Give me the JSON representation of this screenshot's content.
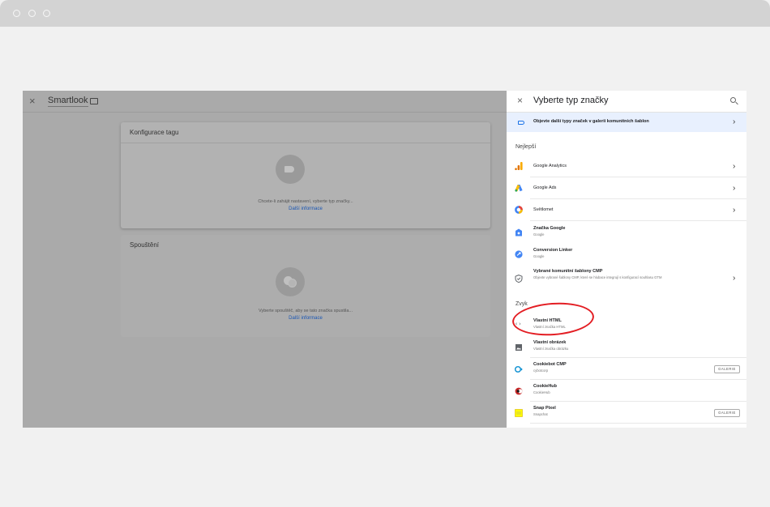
{
  "window": {
    "controls": [
      "close",
      "minimize",
      "zoom"
    ]
  },
  "left_panel": {
    "close_label": "×",
    "title": "Smartlook",
    "tag_card": {
      "title": "Konfigurace tagu",
      "hint": "Chcete-li zahájit nastavení, vyberte typ značky...",
      "link": "Další informace"
    },
    "trigger_card": {
      "title": "Spouštění",
      "hint": "Vyberte spouštěč, aby se tato značka spustila...",
      "link": "Další informace"
    }
  },
  "right_panel": {
    "close_label": "×",
    "title": "Vyberte typ značky",
    "banner": {
      "text": "Objevte další typy značek v galerii komunitních šablon",
      "chevron": "›"
    },
    "sections": {
      "best": "Nejlepší",
      "custom": "Zvyk"
    },
    "best_items": [
      {
        "name": "Google Analytics",
        "icon": "google-analytics-icon",
        "chevron": "›"
      },
      {
        "name": "Google Ads",
        "icon": "google-ads-icon",
        "chevron": "›"
      },
      {
        "name": "Světlomet",
        "icon": "floodlight-icon",
        "chevron": "›"
      },
      {
        "name": "Značka Google",
        "sub": "Google",
        "icon": "google-tag-icon"
      },
      {
        "name": "Conversion Linker",
        "sub": "Google",
        "icon": "conversion-linker-icon"
      },
      {
        "name": "Vybrané komunitní šablony CMP",
        "sub": "Objevte vybrané šablony CMP, které se hlubace integrují s konfigurací souhlasu GTM",
        "icon": "shield-icon",
        "chevron": "›"
      }
    ],
    "custom_items": [
      {
        "name": "Vlastní HTML",
        "sub": "Vlastní značka HTML",
        "icon": "code-icon"
      },
      {
        "name": "Vlastní obrázek",
        "sub": "Vlastní značka obrázku",
        "icon": "image-icon"
      },
      {
        "name": "Cookiebot CMP",
        "sub": "cybotcorp",
        "icon": "cookiebot-icon",
        "badge": "GALERIE"
      },
      {
        "name": "CookieHub",
        "sub": "CookieHub",
        "icon": "cookiehub-icon"
      },
      {
        "name": "Snap Pixel",
        "sub": "Snapchat",
        "icon": "snapchat-icon",
        "badge": "GALERIE"
      }
    ]
  },
  "colors": {
    "accent": "#1a73e8",
    "highlight_ring": "#e31d23",
    "overlay": "#aaaaaa",
    "banner_bg": "#e8f0fe"
  }
}
